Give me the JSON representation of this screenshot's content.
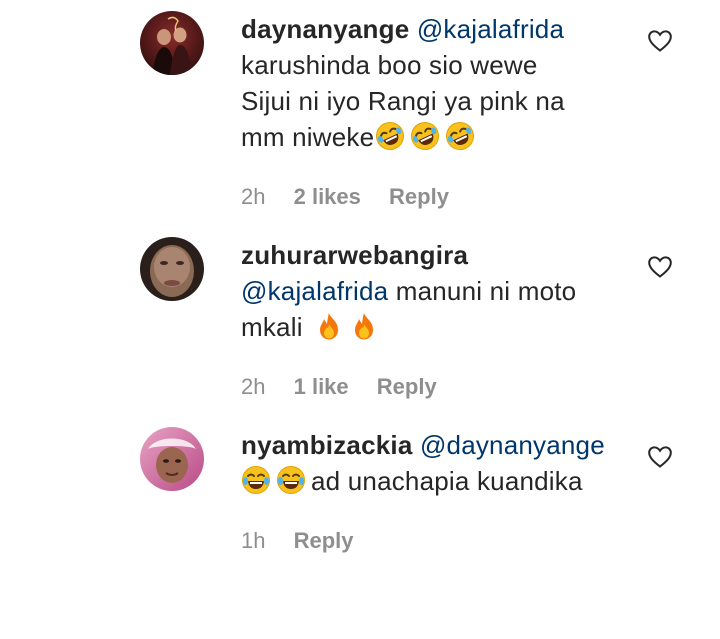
{
  "comments": [
    {
      "username": "daynanyange",
      "mention": "@kajalafrida",
      "lines": [
        "karushinda boo sio wewe",
        "Sijui ni iyo Rangi ya pink na",
        "mm niweke"
      ],
      "trailing_emoji": [
        "rolling-laughing-emoji",
        "rolling-laughing-emoji",
        "rolling-laughing-emoji"
      ],
      "time": "2h",
      "likes": "2 likes",
      "reply_label": "Reply",
      "like_icon": "heart-outline-icon"
    },
    {
      "username": "zuhurarwebangira",
      "mention": "@kajalafrida",
      "lines": [
        "manuni ni moto",
        "mkali"
      ],
      "trailing_emoji": [
        "fire-emoji",
        "fire-emoji"
      ],
      "time": "2h",
      "likes": "1 like",
      "reply_label": "Reply",
      "like_icon": "heart-outline-icon"
    },
    {
      "username": "nyambizackia",
      "mention": "@daynanyange",
      "leading_emoji": [
        "tears-of-joy-emoji",
        "tears-of-joy-emoji"
      ],
      "lines": [
        "ad unachapia kuandika"
      ],
      "time": "1h",
      "reply_label": "Reply",
      "like_icon": "heart-outline-icon"
    }
  ],
  "colors": {
    "text": "#262626",
    "mention": "#00376b",
    "meta": "#8e8e8e"
  }
}
